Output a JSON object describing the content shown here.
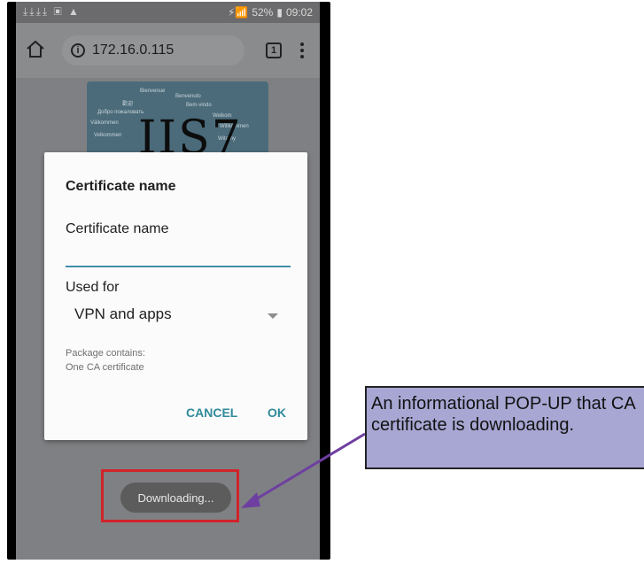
{
  "status_bar": {
    "left_icons": "⤓⤓⤓⤓ ▣ ▲",
    "battery": "52%",
    "time": "09:02"
  },
  "browser": {
    "url": "172.16.0.115",
    "tab_count": "1"
  },
  "banner": {
    "title": "IIS7"
  },
  "dialog": {
    "title": "Certificate name",
    "name_label": "Certificate name",
    "name_value": "",
    "used_for_label": "Used for",
    "used_for_value": "VPN and apps",
    "package_line1": "Package contains:",
    "package_line2": "One CA certificate",
    "cancel_label": "CANCEL",
    "ok_label": "OK"
  },
  "toast": {
    "text": "Downloading..."
  },
  "callout": {
    "text": "An informational POP-UP that CA certificate is downloading."
  },
  "colors": {
    "accent": "#3f8fa8",
    "highlight_box": "#d0242b",
    "callout_bg": "#a8a7d4",
    "arrow": "#6e3fa0"
  }
}
